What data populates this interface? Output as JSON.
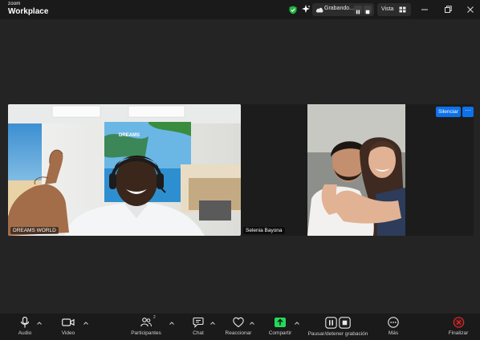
{
  "app": {
    "logo_top": "zoom",
    "logo_bottom": "Workplace"
  },
  "titlebar": {
    "recording_label": "Grabando...",
    "view_label": "Vista",
    "icons": [
      "shield-icon",
      "sparkle-icon",
      "cloud-icon",
      "pause-icon",
      "stop-icon",
      "grid-icon",
      "minimize-icon",
      "maximize-icon",
      "close-icon"
    ]
  },
  "participants": [
    {
      "name": "DREAMS WORLD"
    },
    {
      "name": "Selenia Bayona"
    }
  ],
  "controls": {
    "mute_label": "Silenciar",
    "more_label": "···"
  },
  "toolbar": {
    "audio_label": "Audio",
    "video_label": "Video",
    "participants_label": "Participantes",
    "participants_count": "2",
    "chat_label": "Chat",
    "react_label": "Reaccionar",
    "share_label": "Compartir",
    "recording_label": "Pausar/detener grabación",
    "more_label": "Más",
    "end_label": "Finalizar"
  },
  "colors": {
    "accent": "#0e71eb",
    "share": "#23d959",
    "end": "#e02828",
    "shield": "#23b547"
  }
}
